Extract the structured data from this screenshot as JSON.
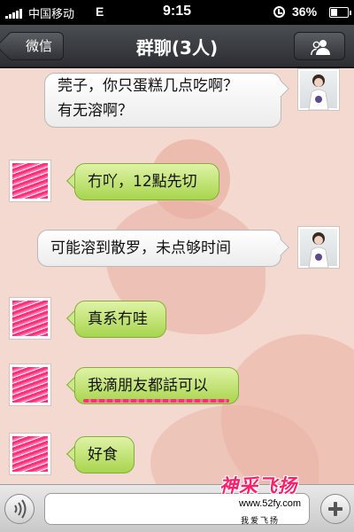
{
  "status_bar": {
    "carrier": "中国移动",
    "network": "E",
    "time": "9:15",
    "battery": "36%"
  },
  "nav": {
    "back_label": "微信",
    "title": "群聊(3人)"
  },
  "messages": [
    {
      "sender": "other-photo",
      "style": "white",
      "side": "right",
      "lines": [
        "莞子，你只蛋糕几点吃啊？",
        "有无溶啊？"
      ]
    },
    {
      "sender": "scribbled",
      "style": "green",
      "side": "left",
      "lines": [
        "冇吖，12點先切"
      ]
    },
    {
      "sender": "other-photo",
      "style": "white",
      "side": "right",
      "lines": [
        "可能溶到散罗，未点够时间"
      ]
    },
    {
      "sender": "scribbled",
      "style": "green",
      "side": "left",
      "lines": [
        "真系冇哇"
      ]
    },
    {
      "sender": "scribbled",
      "style": "green",
      "side": "left",
      "lines": [
        "我滴朋友都話可以"
      ]
    },
    {
      "sender": "scribbled",
      "style": "green",
      "side": "left",
      "lines": [
        "好食"
      ]
    }
  ],
  "input": {
    "value": "",
    "placeholder": ""
  },
  "watermark": {
    "title": "神采飞扬",
    "url": "www.52fy.com",
    "tag": "我爱飞扬"
  },
  "icons": {
    "back": "back-arrow-icon",
    "contacts": "group-contacts-icon",
    "voice": "voice-icon",
    "add": "plus-icon"
  },
  "colors": {
    "nav_bg": "#3b3d41",
    "chat_bg": "#f3d9cf",
    "heart": "#eab1a3",
    "bubble_green": "#b8df62",
    "bubble_white": "#f6f6f6",
    "scribble": "#ff2f7a"
  }
}
